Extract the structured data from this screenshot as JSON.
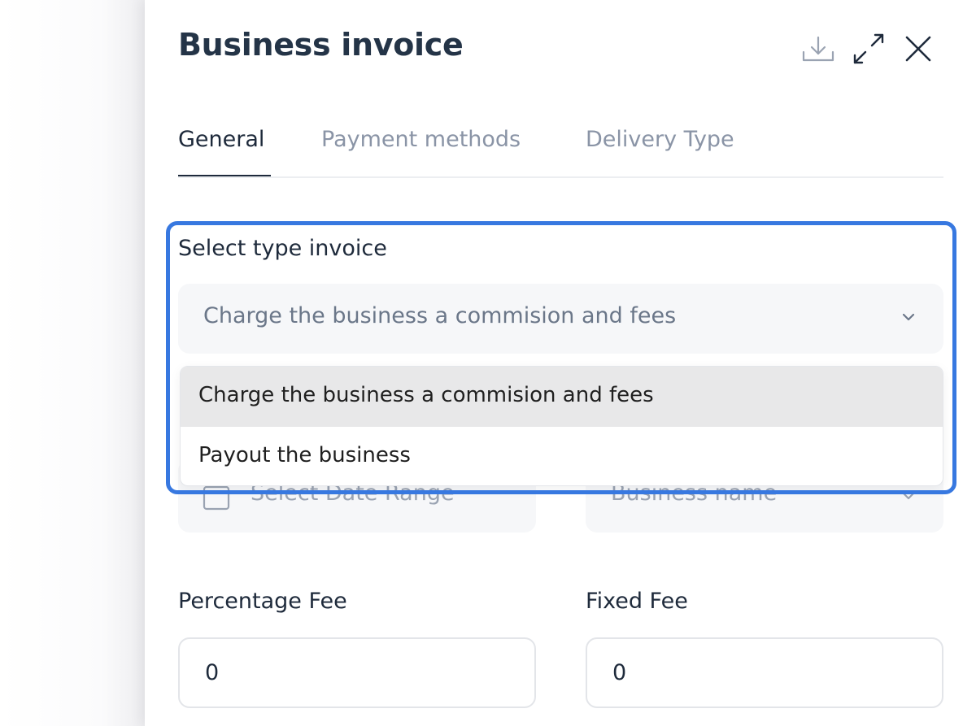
{
  "header": {
    "title": "Business invoice",
    "icons": [
      "download-icon",
      "expand-icon",
      "close-icon"
    ]
  },
  "tabs": [
    {
      "label": "General",
      "active": true
    },
    {
      "label": "Payment methods",
      "active": false
    },
    {
      "label": "Delivery Type",
      "active": false
    }
  ],
  "invoice_type": {
    "label": "Select type invoice",
    "value": "Charge the business a commision and fees",
    "options": [
      {
        "label": "Charge the business a commision and fees",
        "selected": true
      },
      {
        "label": "Payout the business",
        "selected": false
      }
    ]
  },
  "date_range": {
    "placeholder": "Select Date Range"
  },
  "business_name": {
    "placeholder": "Business name"
  },
  "percentage_fee": {
    "label": "Percentage Fee",
    "value": "0"
  },
  "fixed_fee": {
    "label": "Fixed Fee",
    "value": "0"
  },
  "colors": {
    "accent": "#3778e0",
    "title": "#243447",
    "muted": "#8a94a6",
    "field_bg": "#f6f7f9",
    "selected_option_bg": "#e8e8e9"
  }
}
